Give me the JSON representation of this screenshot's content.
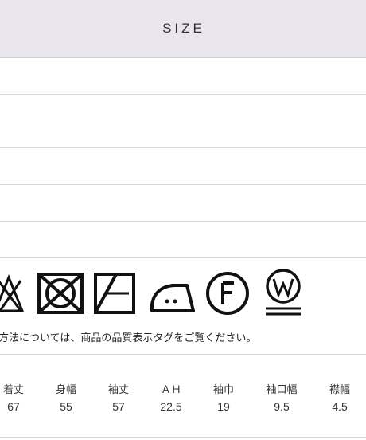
{
  "header": {
    "title": "SIZE"
  },
  "care": {
    "icons": [
      "no-wash-icon",
      "no-bleach-icon",
      "no-tumble-dry-icon",
      "line-dry-icon",
      "iron-low-icon",
      "dry-clean-f-icon",
      "wet-clean-w-icon"
    ],
    "note": "方法については、商品の品質表示タグをご覧ください。"
  },
  "size_table": {
    "columns": [
      {
        "header": "着丈",
        "value": "67"
      },
      {
        "header": "身幅",
        "value": "55"
      },
      {
        "header": "袖丈",
        "value": "57"
      },
      {
        "header": "ＡＨ",
        "value": "22.5"
      },
      {
        "header": "袖巾",
        "value": "19"
      },
      {
        "header": "袖口幅",
        "value": "9.5"
      },
      {
        "header": "襟幅",
        "value": "4.5"
      }
    ]
  }
}
